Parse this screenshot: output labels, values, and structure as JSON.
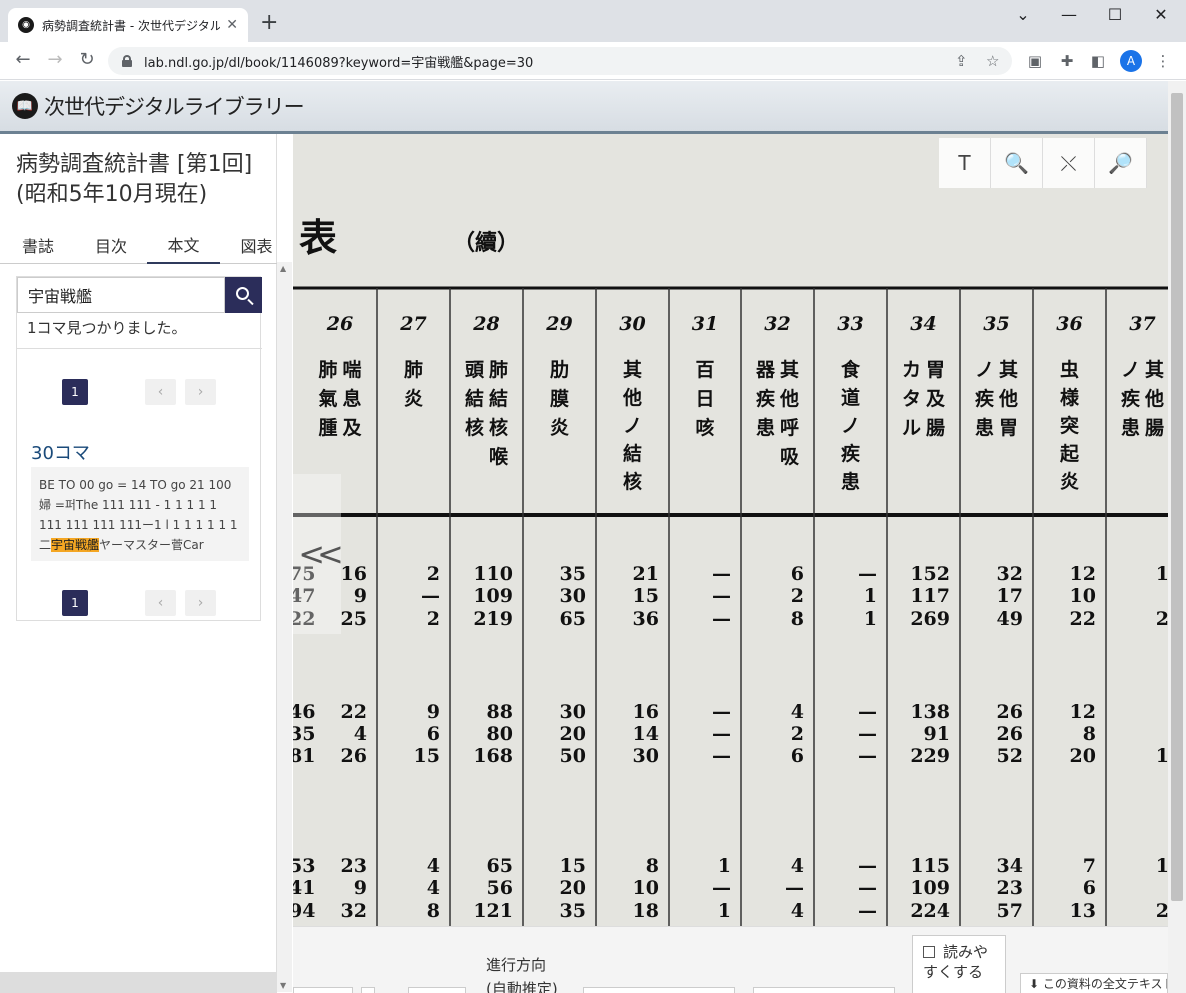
{
  "browser": {
    "tab_title": "病勢調査統計書 - 次世代デジタルラ",
    "tab_close": "✕",
    "new_tab": "+",
    "url": "lab.ndl.go.jp/dl/book/1146089?keyword=宇宙戦艦&page=30",
    "profile_initial": "A",
    "window": {
      "minimize": "⌄",
      "restore": "—",
      "maximize": "☐",
      "close": "✕"
    }
  },
  "site": {
    "name": "次世代デジタルライブラリー"
  },
  "book": {
    "title": "病勢調査統計書 [第1回] (昭和5年10月現在)"
  },
  "tabs": [
    "書誌",
    "目次",
    "本文",
    "図表"
  ],
  "active_tab": "本文",
  "search": {
    "value": "宇宙戦艦",
    "result_text": "1コマ見つかりました。",
    "page": "1",
    "hit_title": "30コマ",
    "snippet_before": "BE TO 00 go = 14 TO go 21 100婦 =퍼The 111 111 - 1 1 1 1 1 111 111 111 111ー1 l 1 1 1 1 1 1 二",
    "snippet_highlight": "宇宙戦艦",
    "snippet_after": "ヤーマスター菅Car"
  },
  "viewer": {
    "toolbar": [
      "T",
      "🔍",
      "⤬",
      "🔎"
    ],
    "prev": "<<",
    "doc_title": "表",
    "doc_subtitle": "（續）",
    "columns": [
      {
        "num": "26",
        "label": "喘息及肺氣腫"
      },
      {
        "num": "27",
        "label": "肺炎"
      },
      {
        "num": "28",
        "label": "肺結核喉頭結核"
      },
      {
        "num": "29",
        "label": "肋膜炎"
      },
      {
        "num": "30",
        "label": "其他ノ結核"
      },
      {
        "num": "31",
        "label": "百日咳"
      },
      {
        "num": "32",
        "label": "其他呼吸器疾患"
      },
      {
        "num": "33",
        "label": "食道ノ疾患"
      },
      {
        "num": "34",
        "label": "胃及腸カタル"
      },
      {
        "num": "35",
        "label": "其他胃ノ疾患"
      },
      {
        "num": "36",
        "label": "虫様突起炎"
      },
      {
        "num": "37",
        "label": "其他腸ノ疾患"
      }
    ],
    "left_partial": [
      "75",
      "47",
      "22",
      "46",
      "35",
      "81",
      "53",
      "41",
      "94"
    ],
    "rows": [
      [
        "16",
        "2",
        "110",
        "35",
        "21",
        "—",
        "6",
        "—",
        "152",
        "32",
        "12",
        "1"
      ],
      [
        "9",
        "—",
        "109",
        "30",
        "15",
        "—",
        "2",
        "1",
        "117",
        "17",
        "10",
        ""
      ],
      [
        "25",
        "2",
        "219",
        "65",
        "36",
        "—",
        "8",
        "1",
        "269",
        "49",
        "22",
        "2"
      ],
      [
        "22",
        "9",
        "88",
        "30",
        "16",
        "—",
        "4",
        "—",
        "138",
        "26",
        "12",
        ""
      ],
      [
        "4",
        "6",
        "80",
        "20",
        "14",
        "—",
        "2",
        "—",
        "91",
        "26",
        "8",
        ""
      ],
      [
        "26",
        "15",
        "168",
        "50",
        "30",
        "—",
        "6",
        "—",
        "229",
        "52",
        "20",
        "1"
      ],
      [
        "23",
        "4",
        "65",
        "15",
        "8",
        "1",
        "4",
        "—",
        "115",
        "34",
        "7",
        "1"
      ],
      [
        "9",
        "4",
        "56",
        "20",
        "10",
        "—",
        "—",
        "—",
        "109",
        "23",
        "6",
        ""
      ],
      [
        "32",
        "8",
        "121",
        "35",
        "18",
        "1",
        "4",
        "—",
        "224",
        "57",
        "13",
        "2"
      ]
    ]
  },
  "bottom": {
    "direction_label": "進行方向",
    "direction_value": "(自動推定)",
    "readable_label": "読みやすくする",
    "fulltext_label": "⬇ この資料の全文テキスト"
  }
}
